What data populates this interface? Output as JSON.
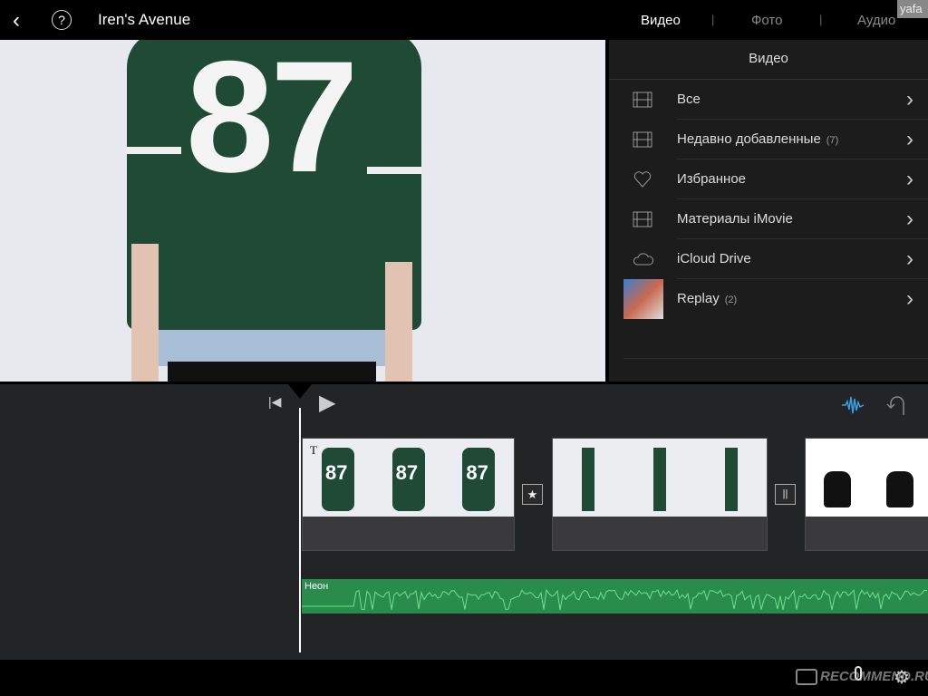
{
  "header": {
    "project_title": "Iren's Avenue",
    "tabs": [
      {
        "label": "Видео",
        "active": true
      },
      {
        "label": "Фото",
        "active": false
      },
      {
        "label": "Аудио",
        "active": false
      }
    ],
    "watermark_user": "yafa"
  },
  "preview": {
    "jersey_number": "87",
    "sweatshirt_color": "#1f4a36"
  },
  "library": {
    "title": "Видео",
    "items": [
      {
        "label": "Все",
        "count": "",
        "icon": "film-icon"
      },
      {
        "label": "Недавно добавленные",
        "count": "(7)",
        "icon": "film-icon"
      },
      {
        "label": "Избранное",
        "count": "",
        "icon": "heart-icon"
      },
      {
        "label": "Материалы iMovie",
        "count": "",
        "icon": "film-icon"
      },
      {
        "label": "iCloud Drive",
        "count": "",
        "icon": "cloud-icon"
      },
      {
        "label": "Replay",
        "count": "(2)",
        "icon": "thumbnail"
      }
    ]
  },
  "timeline": {
    "title_marker": "T",
    "audio_track_label": "Неон",
    "audio_color": "#2a8c4c",
    "waveform_color": "#6fe08f",
    "accent": "#3aa0e0"
  },
  "bottombar": {
    "watermark": "RECOMMEND.RU"
  }
}
